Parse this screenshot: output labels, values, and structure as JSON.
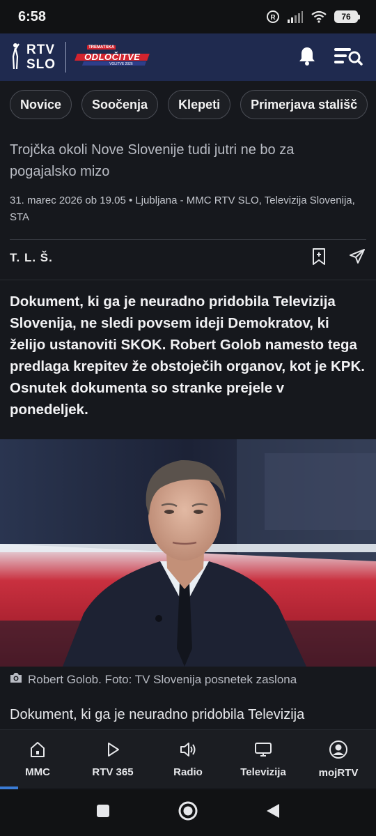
{
  "status_bar": {
    "time": "6:58",
    "battery": "76"
  },
  "header": {
    "logo_line1": "RTV",
    "logo_line2": "SLO",
    "election_badge_top": "TREMATSKA",
    "election_badge_main": "ODLOČITVE",
    "election_badge_sub": "VOLITVE 2026"
  },
  "categories": [
    {
      "label": "Novice"
    },
    {
      "label": "Soočenja"
    },
    {
      "label": "Klepeti"
    },
    {
      "label": "Primerjava stališč"
    }
  ],
  "article": {
    "subtitle": "Trojčka okoli Nove Slovenije tudi jutri ne bo za pogajalsko mizo",
    "meta": "31. marec 2026 ob 19.05 • Ljubljana - MMC RTV SLO, Televizija Slovenija, STA",
    "author": "T. L. Š.",
    "lead": "Dokument, ki ga je neuradno pridobila Televizija Slovenija, ne sledi povsem ideji Demokratov, ki želijo ustanoviti SKOK. Robert Golob namesto tega predlaga krepitev že obstoječih organov, kot je KPK. Osnutek dokumenta so stranke prejele v ponedeljek.",
    "photo_caption": "Robert Golob. Foto: TV Slovenija posnetek zaslona",
    "body_start": "Dokument, ki ga je neuradno pridobila Televizija Slovenija, ne sledi povsem ideji Demokratov"
  },
  "bottom_nav": [
    {
      "label": "MMC",
      "icon": "home-icon"
    },
    {
      "label": "RTV 365",
      "icon": "play-icon"
    },
    {
      "label": "Radio",
      "icon": "speaker-icon"
    },
    {
      "label": "Televizija",
      "icon": "tv-icon"
    },
    {
      "label": "mojRTV",
      "icon": "user-icon"
    }
  ],
  "colors": {
    "header_bg": "#1f2a4f",
    "page_bg": "#16181d",
    "accent": "#3a7bd5"
  }
}
